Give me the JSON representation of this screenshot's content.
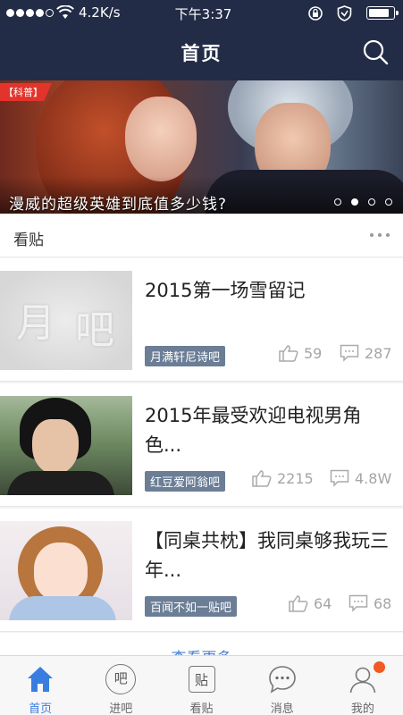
{
  "status_bar": {
    "signal_dots": 5,
    "network_speed": "4.2K/s",
    "time": "下午3:37",
    "battery_level": 0.75
  },
  "header": {
    "title": "首页",
    "search_icon": "search-icon"
  },
  "banner": {
    "tag": "【科普】",
    "caption": "漫威的超级英雄到底值多少钱?",
    "slides": 4,
    "active_slide": 2
  },
  "section": {
    "title": "看贴",
    "more_icon": "more-icon"
  },
  "posts": [
    {
      "title": "2015第一场雪留记",
      "forum": "月满轩尼诗吧",
      "likes": "59",
      "comments": "287"
    },
    {
      "title": "2015年最受欢迎电视男角色...",
      "forum": "红豆爱阿翁吧",
      "likes": "2215",
      "comments": "4.8W"
    },
    {
      "title": "【同桌共枕】我同桌够我玩三年...",
      "forum": "百闻不如一贴吧",
      "likes": "64",
      "comments": "68"
    }
  ],
  "see_more": "查看更多",
  "tabs": [
    {
      "label": "首页",
      "icon": "home-icon",
      "glyph": ""
    },
    {
      "label": "进吧",
      "icon": "ba-icon",
      "glyph": "吧"
    },
    {
      "label": "看贴",
      "icon": "tie-icon",
      "glyph": "贴"
    },
    {
      "label": "消息",
      "icon": "message-icon",
      "glyph": ""
    },
    {
      "label": "我的",
      "icon": "profile-icon",
      "glyph": ""
    }
  ],
  "colors": {
    "header_bg": "#232c47",
    "accent": "#3a7de0",
    "tag_bg": "#6b7e96",
    "badge": "#f15a22",
    "banner_tag": "#e3342c"
  }
}
